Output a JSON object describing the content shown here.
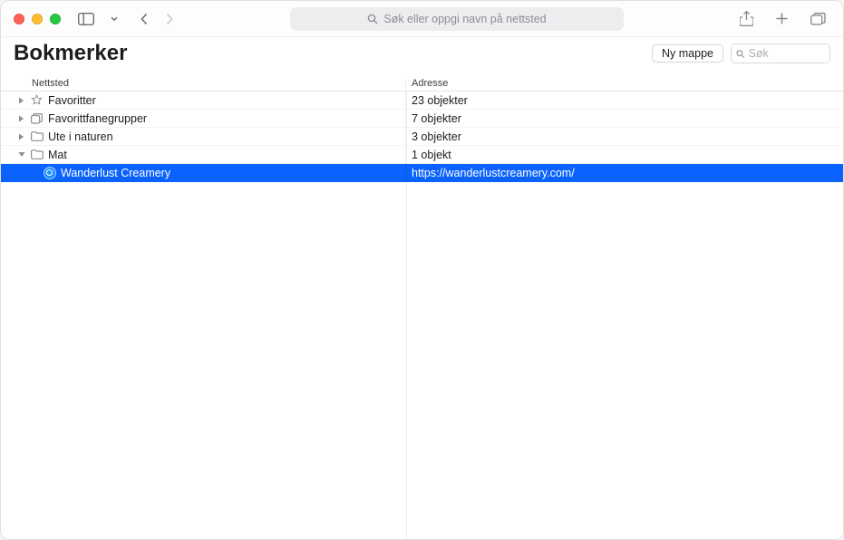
{
  "toolbar": {
    "url_placeholder": "Søk eller oppgi navn på nettsted"
  },
  "header": {
    "title": "Bokmerker",
    "new_folder_label": "Ny mappe",
    "search_placeholder": "Søk"
  },
  "columns": {
    "site": "Nettsted",
    "address": "Adresse"
  },
  "rows": [
    {
      "type": "folder",
      "icon": "star",
      "expanded": false,
      "name": "Favoritter",
      "address": "23 objekter"
    },
    {
      "type": "folder",
      "icon": "tabs",
      "expanded": false,
      "name": "Favorittfanegrupper",
      "address": "7 objekter"
    },
    {
      "type": "folder",
      "icon": "folder",
      "expanded": false,
      "name": "Ute i naturen",
      "address": "3 objekter"
    },
    {
      "type": "folder",
      "icon": "folder",
      "expanded": true,
      "name": "Mat",
      "address": "1 objekt"
    },
    {
      "type": "bookmark",
      "icon": "favicon",
      "selected": true,
      "parent": "Mat",
      "name": "Wanderlust Creamery",
      "address": "https://wanderlustcreamery.com/"
    }
  ]
}
